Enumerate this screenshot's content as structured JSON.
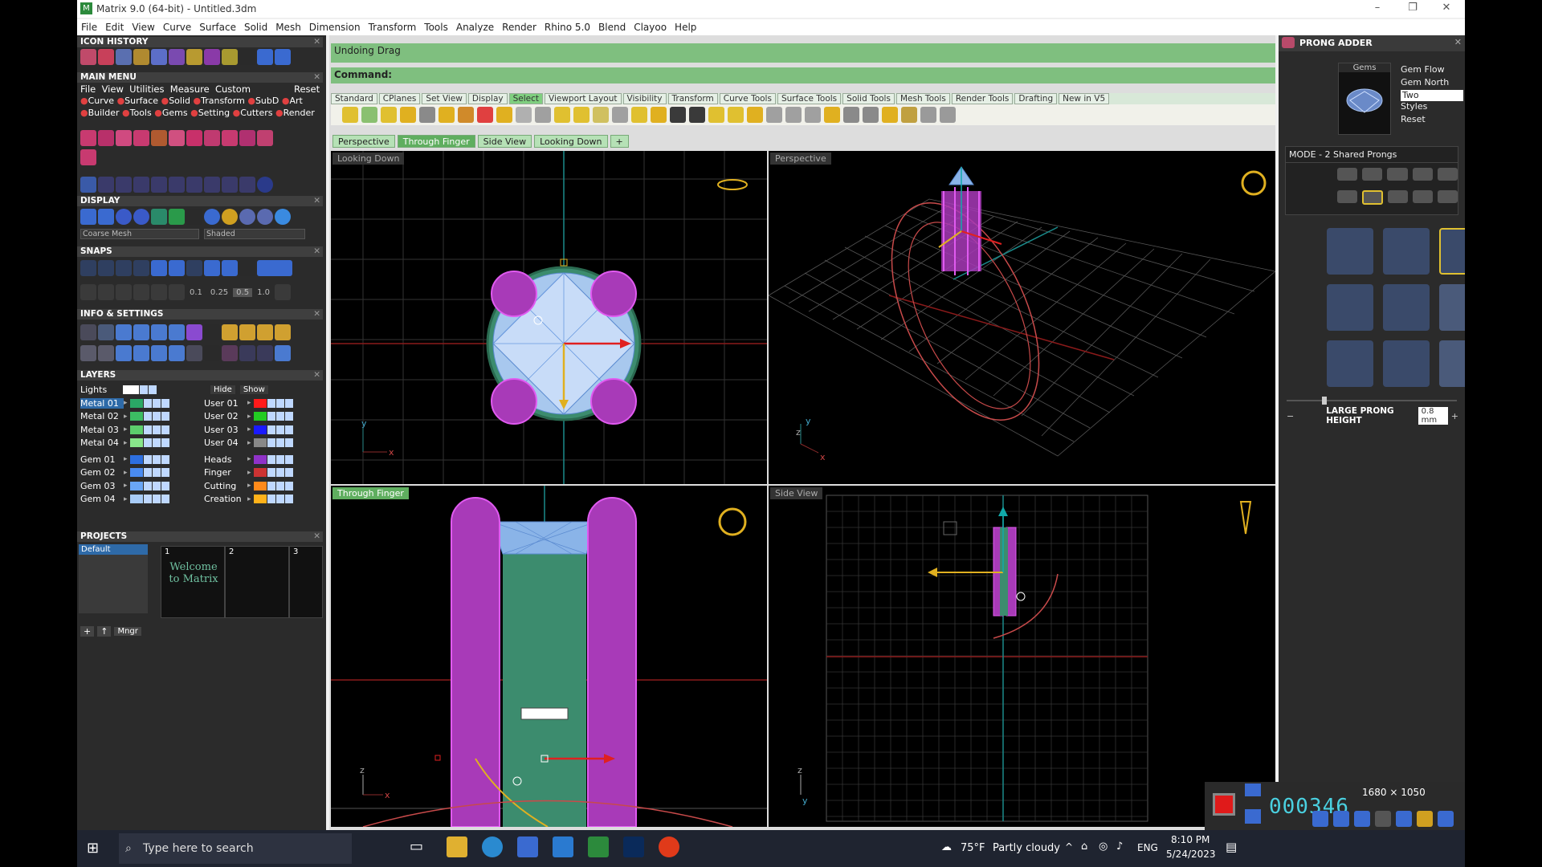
{
  "title": "Matrix 9.0 (64-bit) - Untitled.3dm",
  "menu": [
    "File",
    "Edit",
    "View",
    "Curve",
    "Surface",
    "Solid",
    "Mesh",
    "Dimension",
    "Transform",
    "Tools",
    "Analyze",
    "Render",
    "Rhino 5.0",
    "Blend",
    "Clayoo",
    "Help"
  ],
  "left": {
    "icon_history": "ICON HISTORY",
    "main_menu": "MAIN MENU",
    "main_menu_items": [
      "File",
      "View",
      "Utilities",
      "Measure",
      "Custom"
    ],
    "reset": "Reset",
    "modules_row1": [
      "Curve",
      "Surface",
      "Solid",
      "Transform",
      "SubD",
      "Art"
    ],
    "modules_row2": [
      "Builder",
      "Tools",
      "Gems",
      "Setting",
      "Cutters",
      "Render"
    ],
    "display": "DISPLAY",
    "mesh_mode": "Coarse Mesh",
    "shade_mode": "Shaded",
    "snaps": "SNAPS",
    "snap_values": [
      "0.1",
      "0.25",
      "0.5",
      "1.0"
    ],
    "info": "INFO & SETTINGS",
    "layers": "LAYERS",
    "lights": "Lights",
    "hide": "Hide",
    "show": "Show",
    "layers_left": [
      {
        "n": "Metal 01",
        "c": "#2aa866",
        "sel": true
      },
      {
        "n": "Metal 02",
        "c": "#3cbd63"
      },
      {
        "n": "Metal 03",
        "c": "#5ccf6c"
      },
      {
        "n": "Metal 04",
        "c": "#88e68a"
      },
      {
        "n": "Gem 01",
        "c": "#2d6fe0"
      },
      {
        "n": "Gem 02",
        "c": "#4a8bf0"
      },
      {
        "n": "Gem 03",
        "c": "#6aa6f5"
      },
      {
        "n": "Gem 04",
        "c": "#a8ccf8"
      }
    ],
    "layers_right": [
      {
        "n": "User 01",
        "c": "#ff1a1a"
      },
      {
        "n": "User 02",
        "c": "#22cc22"
      },
      {
        "n": "User 03",
        "c": "#1a1aff"
      },
      {
        "n": "User 04",
        "c": "#888888"
      },
      {
        "n": "Heads",
        "c": "#8f32c8"
      },
      {
        "n": "Finger",
        "c": "#cc3333"
      },
      {
        "n": "Cutting",
        "c": "#ff8a1a"
      },
      {
        "n": "Creation",
        "c": "#ffb21a"
      }
    ],
    "projects": "PROJECTS",
    "project_default": "Default",
    "slots": [
      "1",
      "2",
      "3"
    ],
    "welcome": "Welcome to Matrix",
    "mngr": "Mngr"
  },
  "command": {
    "history": "Undoing Drag",
    "prompt": "Command:"
  },
  "tabs": [
    "Standard",
    "CPlanes",
    "Set View",
    "Display",
    "Select",
    "Viewport Layout",
    "Visibility",
    "Transform",
    "Curve Tools",
    "Surface Tools",
    "Solid Tools",
    "Mesh Tools",
    "Render Tools",
    "Drafting",
    "New in V5"
  ],
  "active_tab": "Select",
  "view_tabs": [
    "Perspective",
    "Through Finger",
    "Side View",
    "Looking Down"
  ],
  "viewports": {
    "tl": "Looking Down",
    "tr": "Perspective",
    "bl": "Through Finger",
    "br": "Side View"
  },
  "axis": {
    "x": "x",
    "y": "y",
    "z": "z"
  },
  "right": {
    "title": "PRONG ADDER",
    "gems": "Gems",
    "opts": [
      "Gem Flow",
      "Gem North",
      "Two",
      "Styles",
      "Reset"
    ],
    "mode": "MODE - 2 Shared Prongs",
    "param": "LARGE PRONG HEIGHT",
    "param_value": "0.8 mm"
  },
  "recorder": {
    "time": "000346",
    "res": "1680 × 1050"
  },
  "taskbar": {
    "search": "Type here to search",
    "weather_temp": "75°F",
    "weather": "Partly cloudy",
    "lang": "ENG",
    "time": "8:10 PM",
    "date": "5/24/2023"
  },
  "colors": {
    "panel": "#2b2b2b",
    "command": "#7fbf7f",
    "accent": "#5fae5f",
    "prong": "#b33cc6",
    "metal": "#3c8c6e"
  }
}
